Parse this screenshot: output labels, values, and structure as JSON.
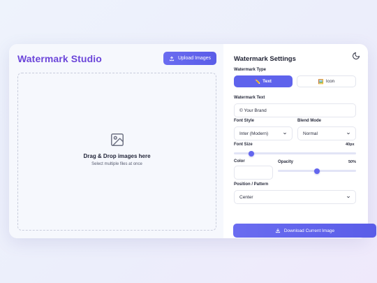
{
  "app": {
    "title": "Watermark Studio"
  },
  "toolbar": {
    "upload_label": "Upload Images"
  },
  "dropzone": {
    "title": "Drag & Drop images here",
    "subtitle": "Select multiple files at once"
  },
  "settings": {
    "title": "Watermark Settings",
    "type_label": "Watermark Type",
    "type_options": [
      {
        "icon": "✏️",
        "label": "Text",
        "active": true
      },
      {
        "icon": "🖼️",
        "label": "Icon",
        "active": false
      }
    ],
    "text_label": "Watermark Text",
    "text_value": "© Your Brand",
    "font_style_label": "Font Style",
    "font_style_value": "Inter (Modern)",
    "blend_mode_label": "Blend Mode",
    "blend_mode_value": "Normal",
    "font_size_label": "Font Size",
    "font_size_value": "40px",
    "font_size_fraction": 0.14,
    "color_label": "Color",
    "color_value": "#ffffff",
    "opacity_label": "Opacity",
    "opacity_value": "50%",
    "opacity_fraction": 0.5,
    "position_label": "Position / Pattern",
    "position_value": "Center",
    "download_label": "Download Current Image"
  },
  "colors": {
    "brand": "#6b45d9",
    "accent": "#5f63ec"
  }
}
